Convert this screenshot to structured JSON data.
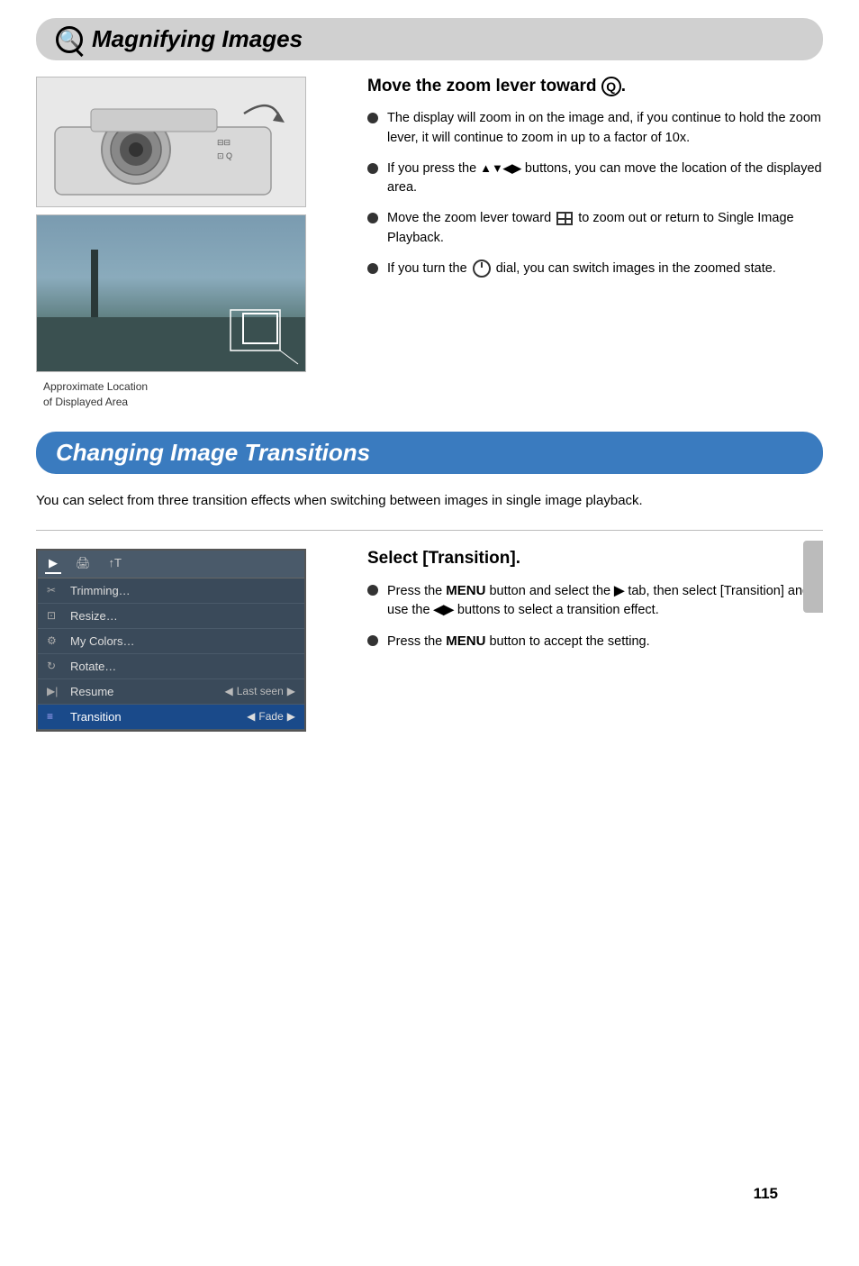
{
  "magnifying": {
    "title": "Magnifying Images",
    "subheading": "Move the zoom lever toward Q.",
    "bullets": [
      "The display will zoom in on the image and, if you continue to hold the zoom lever, it will continue to zoom in up to a factor of 10x.",
      "If you press the ▲▼◀▶ buttons, you can move the location of the displayed area.",
      "Move the zoom lever toward [grid] to zoom out or return to Single Image Playback.",
      "If you turn the [dial] dial, you can switch images in the zoomed state."
    ],
    "caption_line1": "Approximate Location",
    "caption_line2": "of Displayed Area"
  },
  "transitions": {
    "title": "Changing Image Transitions",
    "intro": "You can select from three transition effects when switching between images in single image playback.",
    "subheading": "Select [Transition].",
    "bullets": [
      "Press the MENU button and select the [▶] tab, then select [Transition] and use the ◀▶ buttons to select a transition effect.",
      "Press the MENU button to accept the setting."
    ],
    "menu": {
      "tabs": [
        "▶",
        "🖨",
        "↑↓"
      ],
      "rows": [
        {
          "icon": "✂",
          "label": "Trimming…",
          "value": ""
        },
        {
          "icon": "⊡",
          "label": "Resize…",
          "value": ""
        },
        {
          "icon": "🎨",
          "label": "My Colors…",
          "value": ""
        },
        {
          "icon": "↻",
          "label": "Rotate…",
          "value": ""
        },
        {
          "icon": "▶|",
          "label": "Resume",
          "value": "◀ Last seen ▶",
          "highlighted": false
        },
        {
          "icon": "≡",
          "label": "Transition",
          "value": "◀ Fade ▶",
          "highlighted": true
        }
      ]
    }
  },
  "page_number": "115"
}
